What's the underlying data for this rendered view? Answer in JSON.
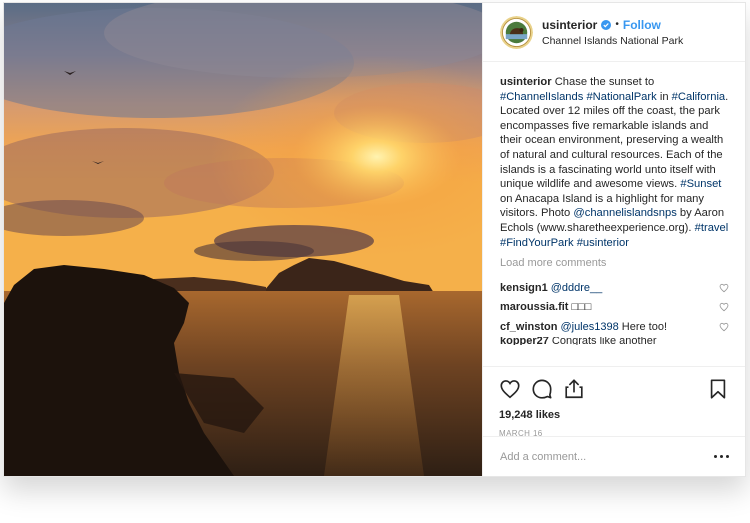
{
  "post": {
    "username": "usinterior",
    "follow_label": "Follow",
    "location": "Channel Islands National Park",
    "caption": {
      "username": "usinterior",
      "parts": [
        {
          "text": " Chase the sunset to ",
          "tag": false
        },
        {
          "text": "#ChannelIslands",
          "tag": true
        },
        {
          "text": " ",
          "tag": false
        },
        {
          "text": "#NationalPark",
          "tag": true
        },
        {
          "text": " in ",
          "tag": false
        },
        {
          "text": "#California",
          "tag": true
        },
        {
          "text": ". Located over 12 miles off the coast, the park encompasses five remarkable islands and their ocean environment, preserving a wealth of natural and cultural resources. Each of the islands is a fascinating world unto itself with unique wildlife and awesome views. ",
          "tag": false
        },
        {
          "text": "#Sunset",
          "tag": true
        },
        {
          "text": " on Anacapa Island is a highlight for many visitors. Photo ",
          "tag": false
        },
        {
          "text": "@channelislandsnps",
          "tag": true
        },
        {
          "text": " by Aaron Echols (www.sharetheexperience.org). ",
          "tag": false
        },
        {
          "text": "#travel",
          "tag": true
        },
        {
          "text": " ",
          "tag": false
        },
        {
          "text": "#FindYourPark",
          "tag": true
        },
        {
          "text": " ",
          "tag": false
        },
        {
          "text": "#usinterior",
          "tag": true
        }
      ]
    },
    "load_more": "Load more comments",
    "comments": [
      {
        "user": "kensign1",
        "text": "@dddre__",
        "mention": true
      },
      {
        "user": "maroussia.fit",
        "text": "□□□",
        "mention": false
      },
      {
        "user": "cf_winston",
        "text": "@jules1398",
        "suffix": " Here too!",
        "mention": true
      },
      {
        "user": "kopper27",
        "text": "Congrats like another",
        "mention": false
      }
    ],
    "likes": "19,248 likes",
    "date": "MARCH 16",
    "add_comment_placeholder": "Add a comment...",
    "icons": {
      "like": "heart-icon",
      "comment": "comment-bubble-icon",
      "share": "share-icon",
      "save": "bookmark-icon",
      "verified": "verified-badge-icon",
      "more": "more-options-icon"
    },
    "colors": {
      "link": "#003569",
      "follow": "#3897f0",
      "verified": "#3897f0",
      "muted": "#999999"
    }
  }
}
